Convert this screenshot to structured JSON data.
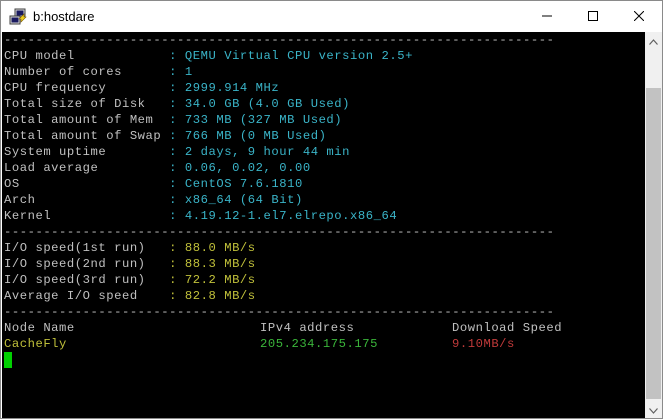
{
  "window": {
    "title": "b:hostdare",
    "controls": {
      "minimize_icon": "minimize-icon",
      "maximize_icon": "maximize-icon",
      "close_icon": "close-icon"
    }
  },
  "terminal": {
    "colors": {
      "background": "#000000",
      "text": "#c0c0c0",
      "value": "#3ab4c8",
      "io_value": "#c0c03a",
      "ipv4": "#3ab43a",
      "speed": "#c03a3a",
      "cursor": "#00d000"
    },
    "separator": "----------------------------------------------------------------------",
    "sysinfo": [
      {
        "label": "CPU model           ",
        "value": ": QEMU Virtual CPU version 2.5+"
      },
      {
        "label": "Number of cores     ",
        "value": ": 1"
      },
      {
        "label": "CPU frequency       ",
        "value": ": 2999.914 MHz"
      },
      {
        "label": "Total size of Disk  ",
        "value": ": 34.0 GB (4.0 GB Used)"
      },
      {
        "label": "Total amount of Mem ",
        "value": ": 733 MB (327 MB Used)"
      },
      {
        "label": "Total amount of Swap",
        "value": ": 766 MB (0 MB Used)"
      },
      {
        "label": "System uptime       ",
        "value": ": 2 days, 9 hour 44 min"
      },
      {
        "label": "Load average        ",
        "value": ": 0.06, 0.02, 0.00"
      },
      {
        "label": "OS                  ",
        "value": ": CentOS 7.6.1810"
      },
      {
        "label": "Arch                ",
        "value": ": x86_64 (64 Bit)"
      },
      {
        "label": "Kernel              ",
        "value": ": 4.19.12-1.el7.elrepo.x86_64"
      }
    ],
    "io": [
      {
        "label": "I/O speed(1st run)  ",
        "value": ": 88.0 MB/s"
      },
      {
        "label": "I/O speed(2nd run)  ",
        "value": ": 88.3 MB/s"
      },
      {
        "label": "I/O speed(3rd run)  ",
        "value": ": 72.2 MB/s"
      },
      {
        "label": "Average I/O speed   ",
        "value": ": 82.8 MB/s"
      }
    ],
    "table": {
      "headers": {
        "node_name": "Node Name",
        "ipv4": "IPv4 address",
        "download_speed": "Download Speed"
      },
      "rows": [
        {
          "node": "CacheFly",
          "ipv4": "205.234.175.175",
          "speed": "9.10MB/s"
        }
      ]
    }
  }
}
